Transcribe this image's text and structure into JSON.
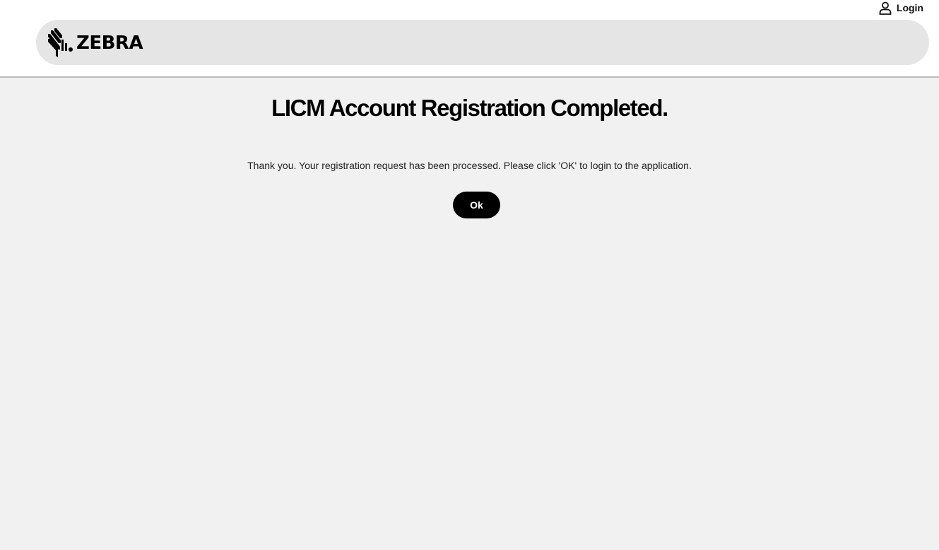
{
  "header": {
    "brand": "ZEBRA",
    "login_label": "Login",
    "icons": {
      "login": "user-icon",
      "logo": "zebra-logo-icon"
    }
  },
  "main": {
    "title": "LICM Account Registration Completed.",
    "message": "Thank you. Your registration request has been processed. Please click 'OK' to login to the application.",
    "ok_button": "Ok"
  },
  "colors": {
    "page_background": "#f1f1f1",
    "header_bar": "#e5e5e5",
    "button": "#000000",
    "button_text": "#ffffff"
  }
}
